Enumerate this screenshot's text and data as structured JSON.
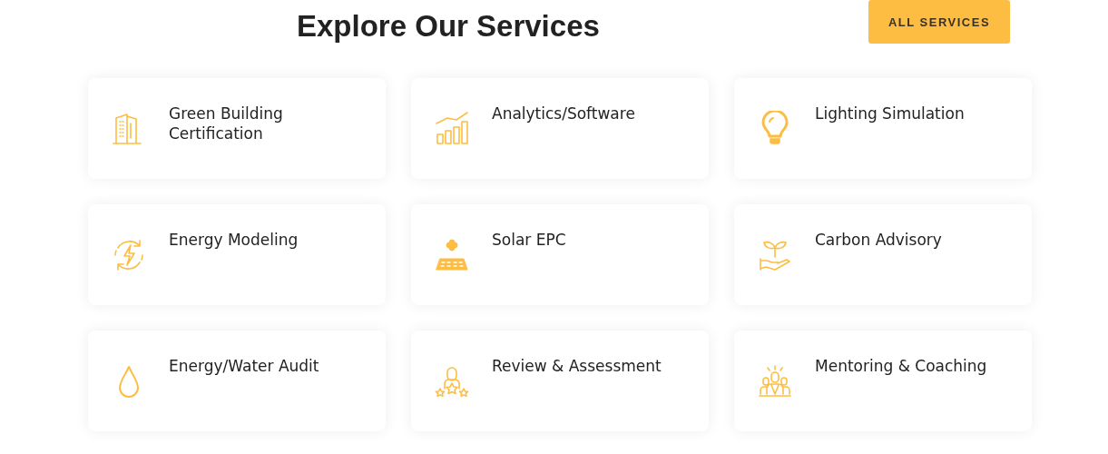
{
  "header": {
    "title": "Explore Our Services",
    "button": "ALL SERVICES"
  },
  "services": [
    {
      "title": "Green Building Certification",
      "kind": "building"
    },
    {
      "title": "Analytics/Software",
      "kind": "chart"
    },
    {
      "title": "Lighting Simulation",
      "kind": "bulb"
    },
    {
      "title": "Energy Modeling",
      "kind": "energy"
    },
    {
      "title": "Solar EPC",
      "kind": "solar"
    },
    {
      "title": "Carbon Advisory",
      "kind": "plant"
    },
    {
      "title": "Energy/Water Audit",
      "kind": "drop"
    },
    {
      "title": "Review & Assessment",
      "kind": "review"
    },
    {
      "title": "Mentoring & Coaching",
      "kind": "team"
    }
  ]
}
